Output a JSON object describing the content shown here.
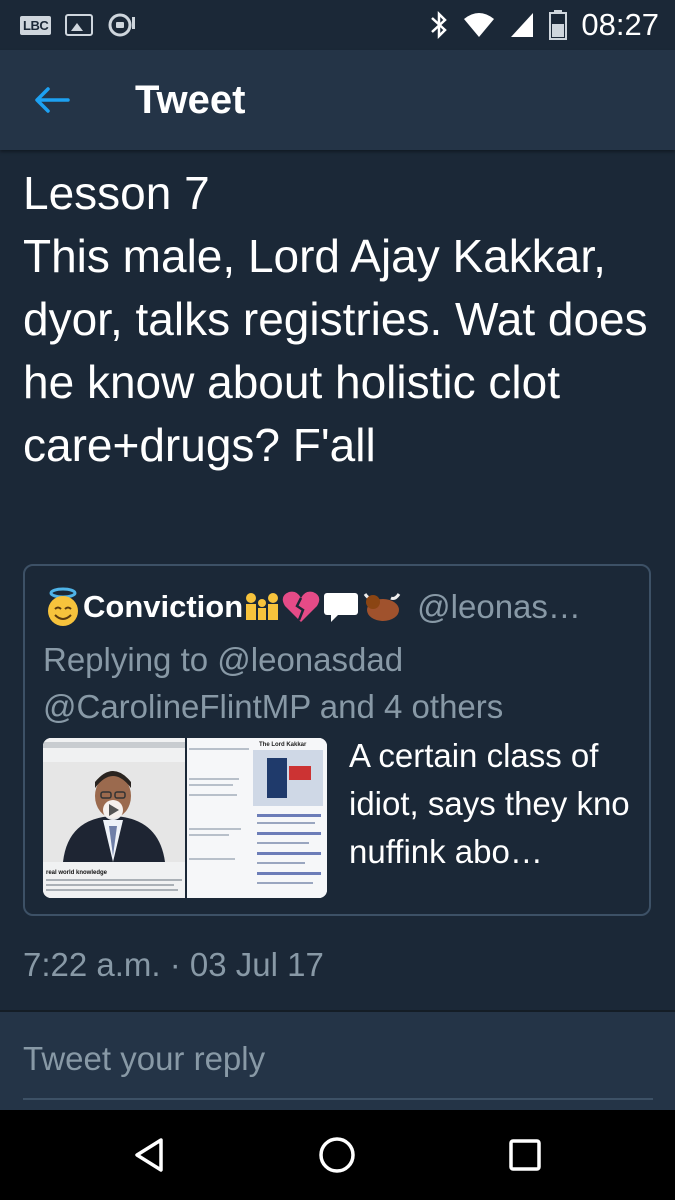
{
  "status_bar": {
    "left_icons": [
      "lbc-app-icon",
      "image-notification-icon",
      "chat-notification-icon"
    ],
    "lbc_label": "LBC",
    "right_icons": [
      "bluetooth-icon",
      "wifi-icon",
      "signal-icon",
      "battery-icon"
    ],
    "time": "08:27"
  },
  "toolbar": {
    "back_icon": "arrow-left-icon",
    "title": "Tweet"
  },
  "tweet": {
    "text": "Lesson 7\nThis male, Lord Ajay Kakkar, dyor, talks registries. Wat does he know about holistic clot care+drugs? F'all",
    "timestamp": "7:22 a.m. · 03 Jul 17"
  },
  "quoted_tweet": {
    "author_name": "Conviction",
    "handle": "@leonas…",
    "replying_to": "Replying to @leonasdad @CarolineFlintMP and 4 others",
    "text": "A certain class of idiot, says they kno nuffink abo…",
    "image1_caption": "real world knowledge",
    "image2_title": "The Lord Kakkar"
  },
  "reply": {
    "placeholder": "Tweet your reply"
  },
  "nav_bar": {
    "buttons": [
      "back-triangle-icon",
      "home-circle-icon",
      "recents-square-icon"
    ]
  },
  "colors": {
    "background": "#1b2837",
    "toolbar": "#243447",
    "accent": "#1da1f2",
    "secondary_text": "#8899a6"
  }
}
